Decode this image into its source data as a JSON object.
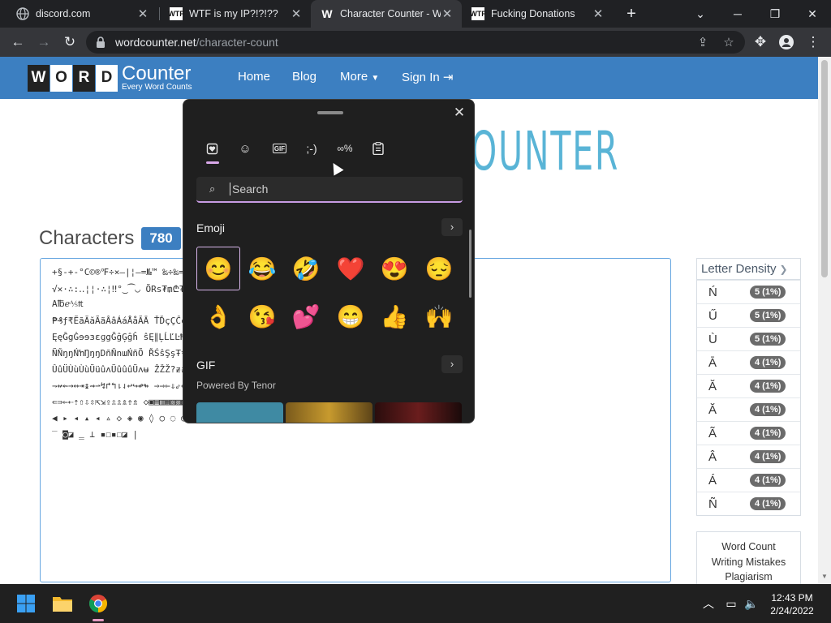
{
  "browser": {
    "tabs": [
      {
        "title": "discord.com",
        "favicon": "discord-globe-icon"
      },
      {
        "title": "WTF is my IP?!?!??",
        "favicon": "wtf-favicon"
      },
      {
        "title": "Character Counter - W",
        "favicon": "w-favicon",
        "active": true
      },
      {
        "title": "Fucking Donations",
        "favicon": "wtf-favicon"
      }
    ],
    "url_domain": "wordcounter.net",
    "url_path": "/character-count"
  },
  "site": {
    "logo_letters": [
      "W",
      "O",
      "R",
      "D"
    ],
    "logo_word": "Counter",
    "logo_tagline": "Every Word Counts",
    "nav": [
      "Home",
      "Blog",
      "More",
      "Sign In"
    ],
    "hero_text": "OUNTER",
    "characters_label": "Characters",
    "characters_count": "780",
    "textarea_lines": [
      "+§-+-°C©®℉÷×–|¦—=№™ ‰÷‰=‡≍※☒∕√%¬·¦;‥·:;.·∴:",
      "√✕·∴:‥¦¦·∴¦‼°‿⁀◡ ÕRs₮₥₾₮₹₵₰₽₿₭₵₣₿₥ ㈜₴₷₯",
      "A℔ℯ⅍₶",
      "₱₰ƒ₹ẼãĂăÃãÂâÁáÅåĂĀ ŤĎçÇĈĉĐđđdzĔëĚěĒèĖéĚèĒë",
      "ĘęĜgĠɘɘɜɛɡgĞĝĢĝĥ ŝĘ∥ĻĹĽĿĦzĥÑnNmMŉŃŇŋŋmŋħ",
      "ÑŇŋŋŃŉŊŋŋDñŇnɯŃñÕ ŘŚŝŞşŦŧþþŢŧŜŠŝŧɕʧʦŭÛŨûŨûŨû",
      "ÛûÜÙùÙùŨüûʌŨûûûŨʌʉ ẐŽŽ?ƶƶƶƶ?S←→↖↗↘↙⇅↕↔↑↓↕↓⇐",
      "⇁↚⇜→↔⇥↨⇝⇀↯↱↰⇂⇃↩↪↫↬ ⇒⇒⇐⇓⇙⇔⇾⇜⇡⇝↗⇛⇔⇓⇟⇘⇜↗",
      "⇚⇛⇐⇠⇡⇧⇩⇳⇱⇲⇪⇫⇬⇭⇮⇯ ◇▣▤▥▦▧▨▩▬▭◀▶◁▷⇔▲△◀▶◅▻",
      "◀ ▸ ◂ ▴ ◂ ▵ ◇ ◈ ◉ ◊ ○ ◌ ◎ ● ◐ ◑ ◒ ◓ ◔ ◕ ◖ ◗ ◘ ◙ ◚ ◛ ◜ ◝ ◞ ◟",
      "‾ ◙◪  ‗  ⊥ ▪☐▪☐◪ |"
    ],
    "letter_density_title": "Letter Density",
    "letter_density": [
      {
        "char": "Ń",
        "value": "5 (1%)"
      },
      {
        "char": "Ű",
        "value": "5 (1%)"
      },
      {
        "char": "Ù",
        "value": "5 (1%)"
      },
      {
        "char": "Ā",
        "value": "4 (1%)"
      },
      {
        "char": "Ă",
        "value": "4 (1%)"
      },
      {
        "char": "Ă",
        "value": "4 (1%)"
      },
      {
        "char": "Ã",
        "value": "4 (1%)"
      },
      {
        "char": "Â",
        "value": "4 (1%)"
      },
      {
        "char": "Á",
        "value": "4 (1%)"
      },
      {
        "char": "Ñ",
        "value": "4 (1%)"
      }
    ],
    "sidebox_links": [
      "Word Count",
      "Writing Mistakes",
      "Plagiarism"
    ]
  },
  "emoji_panel": {
    "search_placeholder": "Search",
    "emoji_section": "Emoji",
    "gif_section": "GIF",
    "powered_by": "Powered By Tenor",
    "emojis": [
      "😊",
      "😂",
      "🤣",
      "❤️",
      "😍",
      "😔",
      "👌",
      "😘",
      "💕",
      "😁",
      "👍",
      "🙌"
    ]
  },
  "taskbar": {
    "time": "12:43 PM",
    "date": "2/24/2022"
  }
}
